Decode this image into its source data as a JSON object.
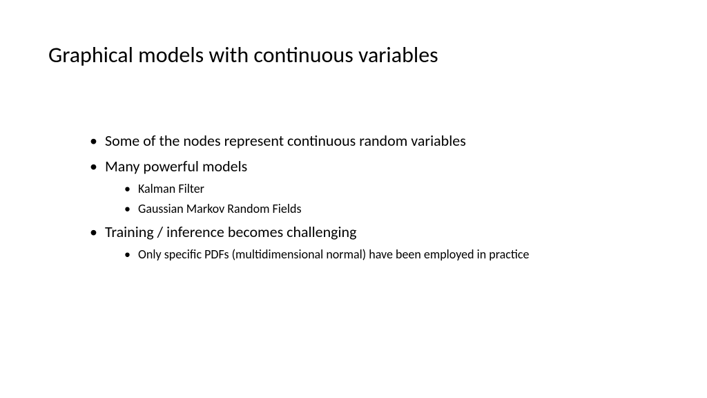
{
  "slide": {
    "title": "Graphical models with continuous variables",
    "bullets": [
      {
        "text": "Some of the nodes represent continuous random variables",
        "children": []
      },
      {
        "text": "Many powerful models",
        "children": [
          "Kalman Filter",
          "Gaussian Markov Random Fields"
        ]
      },
      {
        "text": "Training / inference becomes challenging",
        "children": [
          "Only specific PDFs (multidimensional normal) have been employed in practice"
        ]
      }
    ]
  }
}
